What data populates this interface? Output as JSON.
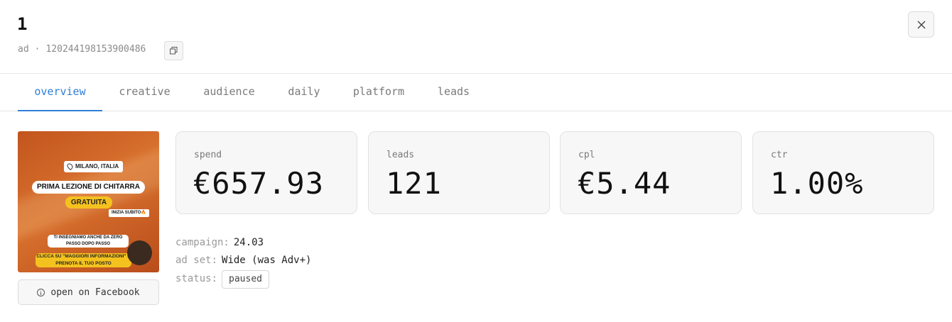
{
  "header": {
    "title": "1",
    "subline_prefix": "ad",
    "separator": "·",
    "ad_id": "120244198153900486"
  },
  "tabs": [
    {
      "label": "overview",
      "active": true
    },
    {
      "label": "creative",
      "active": false
    },
    {
      "label": "audience",
      "active": false
    },
    {
      "label": "daily",
      "active": false
    },
    {
      "label": "platform",
      "active": false
    },
    {
      "label": "leads",
      "active": false
    }
  ],
  "creative": {
    "location": "MILANO, ITALIA",
    "headline": "PRIMA LEZIONE DI CHITARRA",
    "badge": "GRATUITA",
    "cta_small": "INIZIA SUBITO🔥",
    "body": "TI INSEGNIAMO ANCHE DA ZERO PASSO DOPO PASSO",
    "cta": "CLICCA SU \"MAGGIORI INFORMAZIONI\" E PRENOTA IL TUO POSTO",
    "open_button": "open on Facebook"
  },
  "stats": [
    {
      "label": "spend",
      "value": "€657.93"
    },
    {
      "label": "leads",
      "value": "121"
    },
    {
      "label": "cpl",
      "value": "€5.44"
    },
    {
      "label": "ctr",
      "value": "1.00%"
    }
  ],
  "meta": {
    "campaign_label": "campaign:",
    "campaign_value": "24.03",
    "adset_label": "ad set:",
    "adset_value": "Wide (was Adv+)",
    "status_label": "status:",
    "status_value": "paused"
  },
  "colors": {
    "accent": "#2f7ed8",
    "card_bg": "#f7f7f7",
    "creative_orange": "#d8712e",
    "creative_yellow": "#f4c21f"
  },
  "icons": [
    "copy-icon",
    "close-icon",
    "info-icon",
    "location-pin-icon"
  ]
}
